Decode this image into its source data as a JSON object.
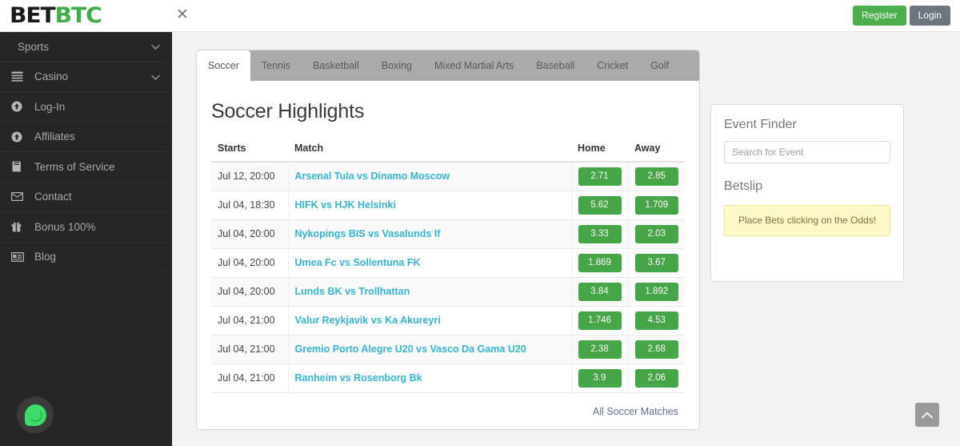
{
  "header": {
    "logo_part1": "BET",
    "logo_part2": "BTC",
    "close_icon": "close-icon",
    "register_label": "Register",
    "login_label": "Login",
    "accent_green": "#4cae4c",
    "login_gray": "#6c757d"
  },
  "sidebar": {
    "background": "#262626",
    "items": [
      {
        "label": "Sports",
        "icon": "none",
        "chevron": true
      },
      {
        "label": "Casino",
        "icon": "cards-icon",
        "chevron": true
      },
      {
        "label": "Log-In",
        "icon": "arrow-up-circle-icon",
        "chevron": false
      },
      {
        "label": "Affiliates",
        "icon": "arrow-up-circle-icon",
        "chevron": false
      },
      {
        "label": "Terms of Service",
        "icon": "book-icon",
        "chevron": false
      },
      {
        "label": "Contact",
        "icon": "envelope-icon",
        "chevron": false
      },
      {
        "label": "Bonus 100%",
        "icon": "gift-icon",
        "chevron": false
      },
      {
        "label": "Blog",
        "icon": "id-card-icon",
        "chevron": false
      }
    ],
    "chat_icon": "chat-bubble-icon"
  },
  "tabs": [
    {
      "label": "Soccer",
      "active": true
    },
    {
      "label": "Tennis",
      "active": false
    },
    {
      "label": "Basketball",
      "active": false
    },
    {
      "label": "Boxing",
      "active": false
    },
    {
      "label": "Mixed Martial Arts",
      "active": false
    },
    {
      "label": "Baseball",
      "active": false
    },
    {
      "label": "Cricket",
      "active": false
    },
    {
      "label": "Golf",
      "active": false
    }
  ],
  "main": {
    "title": "Soccer Highlights",
    "columns": [
      "Starts",
      "Match",
      "Home",
      "Away"
    ],
    "rows": [
      {
        "starts": "Jul 12, 20:00",
        "match": "Arsenal Tula vs Dinamo Moscow",
        "home": "2.71",
        "away": "2.85"
      },
      {
        "starts": "Jul 04, 18:30",
        "match": "HIFK vs HJK Helsinki",
        "home": "5.62",
        "away": "1.709"
      },
      {
        "starts": "Jul 04, 20:00",
        "match": "Nykopings BIS vs Vasalunds If",
        "home": "3.33",
        "away": "2.03"
      },
      {
        "starts": "Jul 04, 20:00",
        "match": "Umea Fc vs Sollentuna FK",
        "home": "1.869",
        "away": "3.67"
      },
      {
        "starts": "Jul 04, 20:00",
        "match": "Lunds BK vs Trollhattan",
        "home": "3.84",
        "away": "1.892"
      },
      {
        "starts": "Jul 04, 21:00",
        "match": "Valur Reykjavik vs Ka Akureyri",
        "home": "1.746",
        "away": "4.53"
      },
      {
        "starts": "Jul 04, 21:00",
        "match": "Gremio Porto Alegre U20 vs Vasco Da Gama U20",
        "home": "2.38",
        "away": "2.68"
      },
      {
        "starts": "Jul 04, 21:00",
        "match": "Ranheim vs Rosenborg Bk",
        "home": "3.9",
        "away": "2.06"
      }
    ],
    "all_matches_label": "All Soccer Matches",
    "odds_color": "#46a546",
    "link_color": "#34b3d4"
  },
  "right_panel": {
    "event_finder_title": "Event Finder",
    "search_placeholder": "Search for Event",
    "search_value": "",
    "betslip_title": "Betslip",
    "betslip_message": "Place Bets clicking on the Odds!",
    "betslip_bg": "#fcf8c8",
    "betslip_text_color": "#8a6d3b"
  },
  "scroll_top": {
    "icon": "chevron-up-icon"
  }
}
